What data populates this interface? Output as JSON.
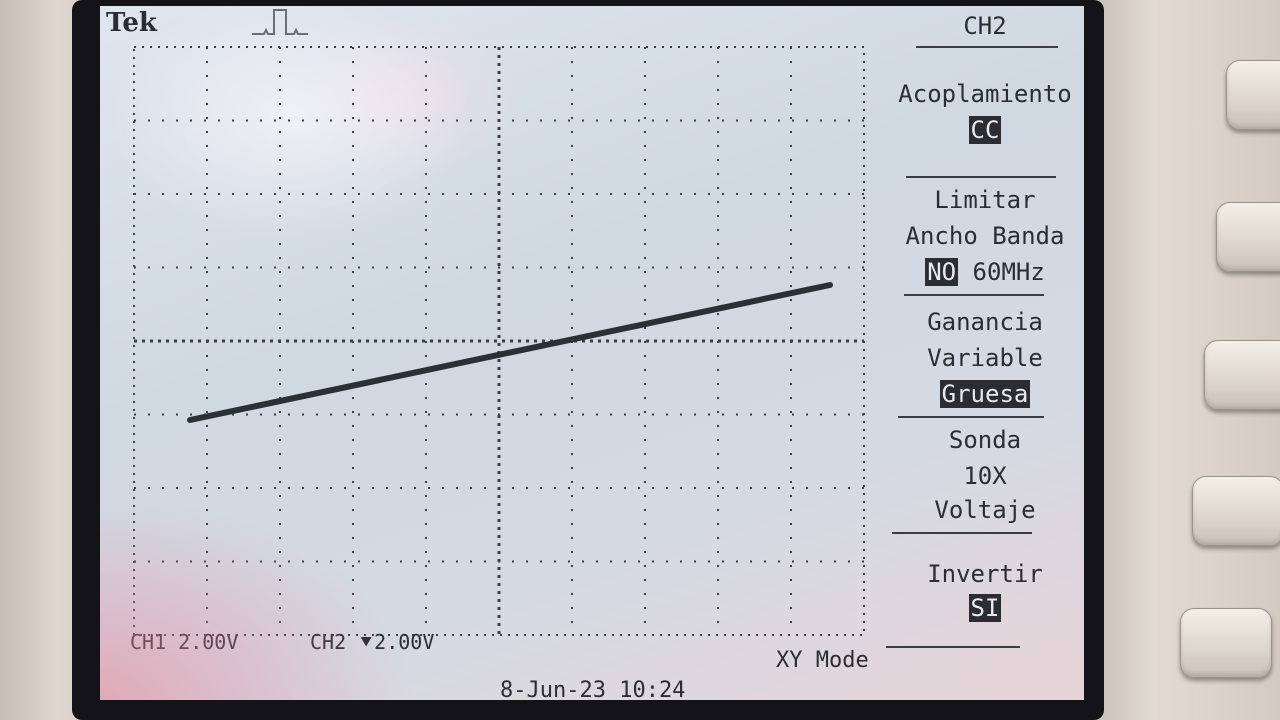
{
  "scope": {
    "brand": "Tek",
    "ch1_readout": "CH1  2.00V",
    "ch2_readout": "CH2 ⯆2.00V",
    "mode": "XY Mode",
    "datetime": "8-Jun-23 10:24"
  },
  "menu": {
    "title": "CH2",
    "coupling": {
      "label": "Acoplamiento",
      "value": "CC"
    },
    "bandwidth": {
      "line1": "Limitar",
      "line2": "Ancho Banda",
      "selected": "NO",
      "other": "60MHz"
    },
    "gain": {
      "line1": "Ganancia",
      "line2": "Variable",
      "value": "Gruesa"
    },
    "probe": {
      "line1": "Sonda",
      "line2": "10X",
      "line3": "Voltaje"
    },
    "invert": {
      "label": "Invertir",
      "value": "SI"
    }
  },
  "colors": {
    "trace": "#2b2f36",
    "screen": "#d6dde6",
    "grid": "#3a3e46"
  }
}
